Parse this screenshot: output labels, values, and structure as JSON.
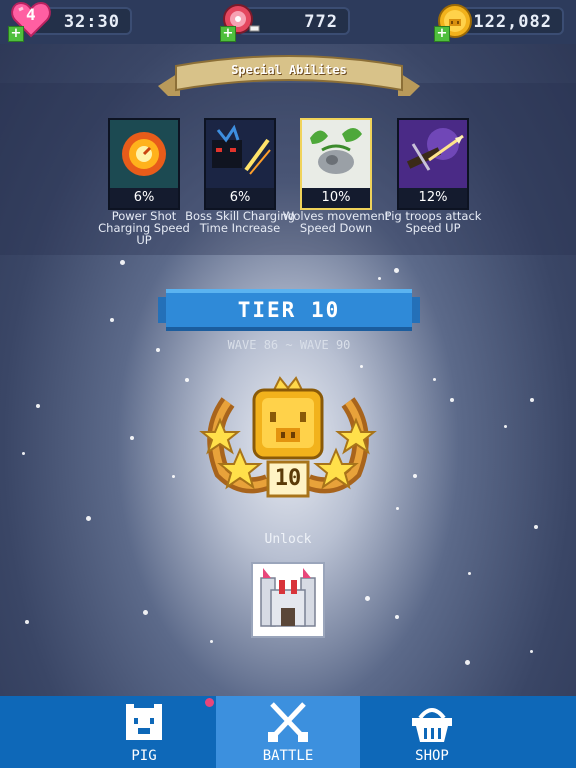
{
  "hud": {
    "hearts": "4",
    "timer": "32:30",
    "meat": "772",
    "coins": "122,082"
  },
  "special_abilities": {
    "title": "Special Abilites",
    "items": [
      {
        "percent": "6%",
        "label": "Power Shot Charging Speed UP",
        "icon": "fire-target-icon"
      },
      {
        "percent": "6%",
        "label": "Boss Skill Charging Time Increase",
        "icon": "boss-slash-icon"
      },
      {
        "percent": "10%",
        "label": "Wolves movement Speed Down",
        "icon": "wolf-icon"
      },
      {
        "percent": "12%",
        "label": "Pig troops attack Speed UP",
        "icon": "crossbow-icon"
      }
    ]
  },
  "tier": {
    "title": "TIER 10",
    "waves": "WAVE 86 ~ WAVE 90",
    "badge_number": "10",
    "unlock_label": "Unlock"
  },
  "nav": {
    "items": [
      {
        "label": "PIG",
        "icon": "pig-icon",
        "active": false
      },
      {
        "label": "BATTLE",
        "icon": "crossed-swords-icon",
        "active": true
      },
      {
        "label": "SHOP",
        "icon": "basket-icon",
        "active": false
      }
    ]
  },
  "colors": {
    "nav_bg": "#0e68b8",
    "nav_active": "#3c90de",
    "tier_banner": "#2f8ad8",
    "selected_border": "#f0d35a"
  }
}
